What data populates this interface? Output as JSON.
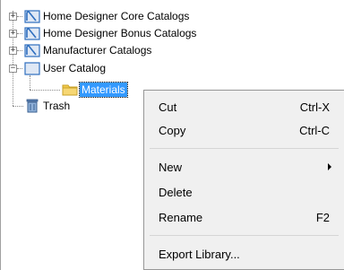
{
  "tree": {
    "items": [
      {
        "label": "Home Designer Core Catalogs",
        "expander": "+"
      },
      {
        "label": "Home Designer Bonus Catalogs",
        "expander": "+"
      },
      {
        "label": "Manufacturer Catalogs",
        "expander": "+"
      },
      {
        "label": "User Catalog",
        "expander": "−"
      },
      {
        "label": "Materials"
      },
      {
        "label": "Trash"
      }
    ]
  },
  "context_menu": {
    "items": [
      {
        "label": "Cut",
        "shortcut": "Ctrl-X"
      },
      {
        "label": "Copy",
        "shortcut": "Ctrl-C"
      },
      {
        "label": "New"
      },
      {
        "label": "Delete"
      },
      {
        "label": "Rename",
        "shortcut": "F2"
      },
      {
        "label": "Export Library..."
      }
    ]
  },
  "colors": {
    "selection": "#3399ff",
    "menu_bg": "#f0f0f0",
    "catalog_icon": "#2f6fbf",
    "folder": "#f2c94c"
  }
}
